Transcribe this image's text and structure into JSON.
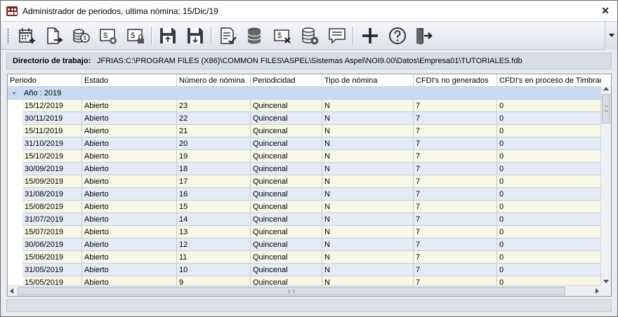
{
  "window": {
    "title": "Administrador de periodos, ultima nómina: 15/Dic/19"
  },
  "toolbar": {
    "buttons": [
      {
        "icon": "calendar-add-icon"
      },
      {
        "icon": "document-export-icon"
      },
      {
        "icon": "coins-stack-icon"
      },
      {
        "icon": "money-settings-icon"
      },
      {
        "icon": "money-lock-icon"
      },
      {
        "icon": "save-upload-icon"
      },
      {
        "icon": "save-download-icon"
      },
      {
        "icon": "document-check-icon"
      },
      {
        "icon": "database-icon"
      },
      {
        "icon": "money-cancel-icon"
      },
      {
        "icon": "database-settings-icon"
      },
      {
        "icon": "message-icon"
      },
      {
        "icon": "add-icon"
      },
      {
        "icon": "help-icon"
      },
      {
        "icon": "exit-icon"
      }
    ]
  },
  "directory": {
    "label": "Directorio de trabajo:",
    "value": "JFRIAS:C:\\PROGRAM FILES (X86)\\COMMON FILES\\ASPEL\\Sistemas Aspel\\NOI9.00\\Datos\\Empresa01\\TUTORIALES.fdb"
  },
  "grid": {
    "columns": [
      "Periodo",
      "Estado",
      "Número de nómina",
      "Periodicidad",
      "Tipo de nómina",
      "CFDI's no generados",
      "CFDI's en proceso de Timbrado"
    ],
    "group_label": "Año : 2019",
    "rows": [
      [
        "15/12/2019",
        "Abierto",
        "23",
        "Quincenal",
        "N",
        "7",
        "0"
      ],
      [
        "30/11/2019",
        "Abierto",
        "22",
        "Quincenal",
        "N",
        "7",
        "0"
      ],
      [
        "15/11/2019",
        "Abierto",
        "21",
        "Quincenal",
        "N",
        "7",
        "0"
      ],
      [
        "31/10/2019",
        "Abierto",
        "20",
        "Quincenal",
        "N",
        "7",
        "0"
      ],
      [
        "15/10/2019",
        "Abierto",
        "19",
        "Quincenal",
        "N",
        "7",
        "0"
      ],
      [
        "30/09/2019",
        "Abierto",
        "18",
        "Quincenal",
        "N",
        "7",
        "0"
      ],
      [
        "15/09/2019",
        "Abierto",
        "17",
        "Quincenal",
        "N",
        "7",
        "0"
      ],
      [
        "31/08/2019",
        "Abierto",
        "16",
        "Quincenal",
        "N",
        "7",
        "0"
      ],
      [
        "15/08/2019",
        "Abierto",
        "15",
        "Quincenal",
        "N",
        "7",
        "0"
      ],
      [
        "31/07/2019",
        "Abierto",
        "14",
        "Quincenal",
        "N",
        "7",
        "0"
      ],
      [
        "15/07/2019",
        "Abierto",
        "13",
        "Quincenal",
        "N",
        "7",
        "0"
      ],
      [
        "30/06/2019",
        "Abierto",
        "12",
        "Quincenal",
        "N",
        "7",
        "0"
      ],
      [
        "15/06/2019",
        "Abierto",
        "11",
        "Quincenal",
        "N",
        "7",
        "0"
      ],
      [
        "31/05/2019",
        "Abierto",
        "10",
        "Quincenal",
        "N",
        "7",
        "0"
      ],
      [
        "15/05/2019",
        "Abierto",
        "9",
        "Quincenal",
        "N",
        "7",
        "0"
      ]
    ]
  }
}
